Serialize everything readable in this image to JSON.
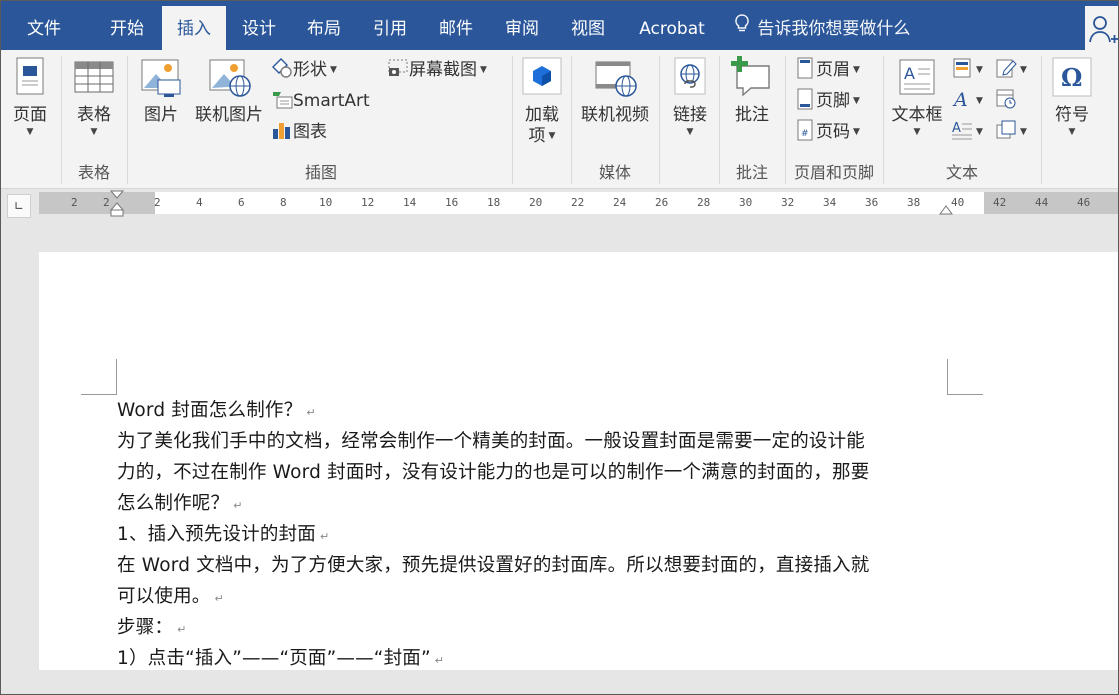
{
  "tabs": [
    {
      "label": "文件"
    },
    {
      "label": "开始"
    },
    {
      "label": "插入"
    },
    {
      "label": "设计"
    },
    {
      "label": "布局"
    },
    {
      "label": "引用"
    },
    {
      "label": "邮件"
    },
    {
      "label": "审阅"
    },
    {
      "label": "视图"
    },
    {
      "label": "Acrobat"
    }
  ],
  "tell_me": "告诉我你想要做什么",
  "ribbon": {
    "pages": {
      "button": "页面"
    },
    "tables": {
      "button": "表格",
      "group": "表格"
    },
    "illustrations": {
      "picture": "图片",
      "online_picture": "联机图片",
      "shapes": "形状",
      "smartart": "SmartArt",
      "chart": "图表",
      "screenshot": "屏幕截图",
      "group": "插图"
    },
    "addins": {
      "button_line1": "加载",
      "button_line2": "项"
    },
    "media": {
      "online_video": "联机视频",
      "group": "媒体"
    },
    "links": {
      "button": "链接"
    },
    "comments": {
      "button": "批注",
      "group": "批注"
    },
    "header_footer": {
      "header": "页眉",
      "footer": "页脚",
      "page_number": "页码",
      "group": "页眉和页脚"
    },
    "text": {
      "textbox": "文本框",
      "group": "文本"
    },
    "symbols": {
      "button": "符号"
    }
  },
  "ruler_ticks": [
    "2",
    "2",
    "2",
    "4",
    "6",
    "8",
    "10",
    "12",
    "14",
    "16",
    "18",
    "20",
    "22",
    "24",
    "26",
    "28",
    "30",
    "32",
    "34",
    "36",
    "38",
    "40",
    "42",
    "44",
    "46"
  ],
  "document": {
    "lines": [
      "Word 封面怎么制作？",
      "为了美化我们手中的文档，经常会制作一个精美的封面。一般设置封面是需要一定的设计能",
      "力的，不过在制作 Word 封面时，没有设计能力的也是可以的制作一个满意的封面的，那要",
      "怎么制作呢？",
      "1、插入预先设计的封面",
      "在 Word 文档中，为了方便大家，预先提供设置好的封面库。所以想要封面的，直接插入就",
      "可以使用。",
      "步骤：",
      "1）点击“插入”——“页面”——“封面”"
    ]
  },
  "colors": {
    "accent": "#2b579a",
    "ribbon_bg": "#f3f3f3",
    "canvas_bg": "#e6e6e6"
  }
}
